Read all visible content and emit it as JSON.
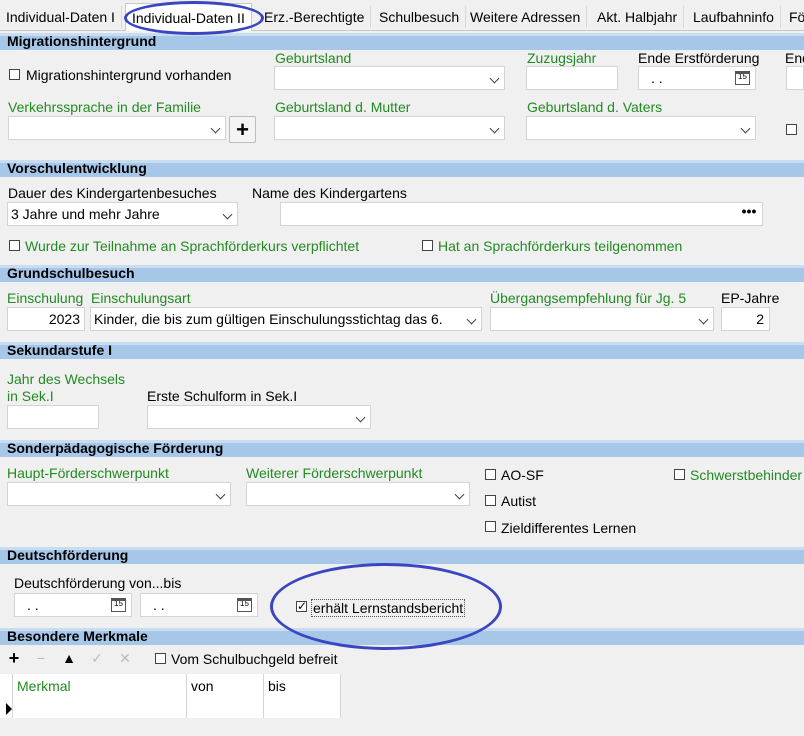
{
  "tabs": [
    {
      "label": "Individual-Daten I"
    },
    {
      "label": "Individual-Daten II"
    },
    {
      "label": "Erz.-Berechtigte"
    },
    {
      "label": "Schulbesuch"
    },
    {
      "label": "Weitere Adressen"
    },
    {
      "label": "Akt. Halbjahr"
    },
    {
      "label": "Laufbahninfo"
    },
    {
      "label": "Fö"
    }
  ],
  "migration": {
    "header": "Migrationshintergrund",
    "checkbox_label": "Migrationshintergrund vorhanden",
    "geburtsland_label": "Geburtsland",
    "zuzugsjahr_label": "Zuzugsjahr",
    "ende_erstfoerderung_label": "Ende Erstförderung",
    "ende_erstfoerderung_value": " .  .",
    "cut_label": "End",
    "verkehrssprache_label": "Verkehrssprache in der Familie",
    "plus_label": "+",
    "geburtsland_mutter_label": "Geburtsland d. Mutter",
    "geburtsland_vaters_label": "Geburtsland d. Vaters"
  },
  "vorschule": {
    "header": "Vorschulentwicklung",
    "dauer_label": "Dauer des Kindergartenbesuches",
    "dauer_value": "3 Jahre und mehr Jahre",
    "name_label": "Name des Kindergartens",
    "dots_label": "•••",
    "sprachfoerder_pflicht_label": "Wurde zur Teilnahme an Sprachförderkurs verpflichtet",
    "sprachfoerder_teil_label": "Hat an Sprachförderkurs teilgenommen"
  },
  "grundschule": {
    "header": "Grundschulbesuch",
    "einschulung_label": "Einschulung",
    "einschulung_value": "2023",
    "einschulungsart_label": "Einschulungsart",
    "einschulungsart_value": "Kinder, die bis zum gültigen Einschulungsstichtag das 6.",
    "uebergang_label": "Übergangsempfehlung für Jg. 5",
    "ep_jahre_label": "EP-Jahre",
    "ep_jahre_value": "2"
  },
  "sek1": {
    "header": "Sekundarstufe I",
    "jahr_wechsel_label_1": "Jahr des Wechsels",
    "jahr_wechsel_label_2": "in Sek.I",
    "erste_schulform_label": "Erste Schulform in Sek.I"
  },
  "sonder": {
    "header": "Sonderpädagogische Förderung",
    "haupt_label": "Haupt-Förderschwerpunkt",
    "weiterer_label": "Weiterer Förderschwerpunkt",
    "ao_sf_label": "AO-SF",
    "autist_label": "Autist",
    "zieldiff_label": "Zieldifferentes Lernen",
    "schwerstbehindert_label": "Schwerstbehinder"
  },
  "deutsch": {
    "header": "Deutschförderung",
    "von_bis_label": "Deutschförderung von...bis",
    "von_value": " .  .",
    "bis_value": " .  .",
    "lernstand_label": "erhält Lernstandsbericht"
  },
  "merkmale": {
    "header": "Besondere Merkmale",
    "schulbuchgeld_label": "Vom Schulbuchgeld befreit",
    "col_merkmal": "Merkmal",
    "col_von": "von",
    "col_bis": "bis"
  },
  "colors": {
    "section_header": "#a7c7e9",
    "green_label": "#228b22",
    "annotation": "#3a45c0"
  }
}
